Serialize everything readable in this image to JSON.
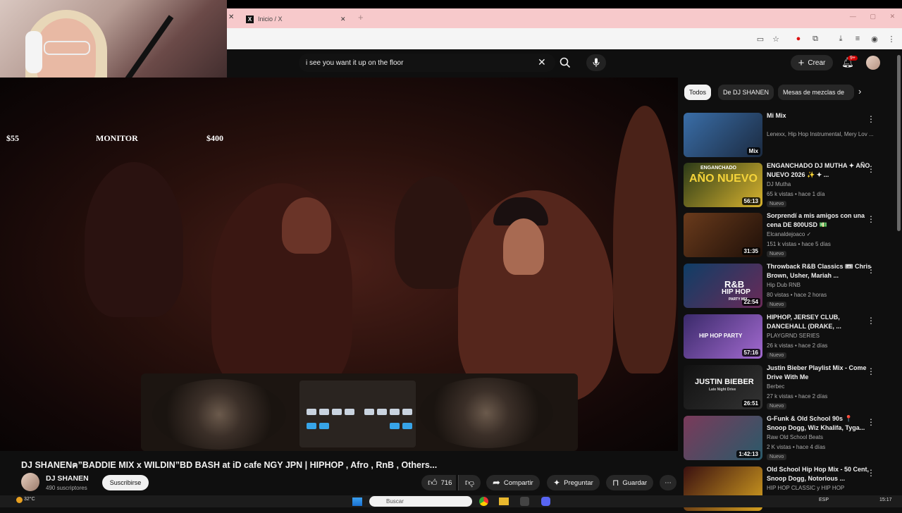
{
  "overlay": {
    "monitor_left": "$55",
    "monitor_label": "MONITOR",
    "monitor_right": "$400",
    "progress": 0.13
  },
  "browser": {
    "tab_title": "Inicio / X",
    "close_glyph": "✕",
    "new_tab_glyph": "+"
  },
  "youtube": {
    "search_value": "i see you want it up on the floor",
    "create_label": "Crear",
    "notif_count": "9+"
  },
  "video": {
    "title": "DJ SHANENฅ”BADDIE MIX x WILDIN”BD BASH at iD cafe NGY JPN | HIPHOP , Afro , RnB , Others...",
    "channel": "DJ SHANEN",
    "subscribers": "490 suscriptores",
    "subscribe_label": "Suscribirse",
    "likes": "716",
    "share_label": "Compartir",
    "ask_label": "Preguntar",
    "save_label": "Guardar"
  },
  "chips": [
    "Todos",
    "De DJ SHANEN",
    "Mesas de mezclas de"
  ],
  "recs": [
    {
      "title": "Mi Mix",
      "channel": "Lenexx, Hip Hop Instrumental, Mery Lov ...",
      "meta": "",
      "badge": "",
      "duration": "Mix",
      "colors": [
        "#3a6ea8",
        "#1b2a40"
      ]
    },
    {
      "title": "ENGANCHADO DJ MUTHA ✦ AÑO NUEVO 2026 ✨ ✦ ...",
      "channel": "DJ Mutha",
      "meta": "65 k vistas • hace 1 día",
      "badge": "Nuevo",
      "duration": "56:13",
      "colors": [
        "#2b3a18",
        "#d8b32e"
      ]
    },
    {
      "title": "Sorprendí a mis amigos con una cena DE 800USD 💵",
      "channel": "Elcanaldejoaco ✓",
      "meta": "151 k vistas • hace 5 días",
      "badge": "Nuevo",
      "duration": "31:35",
      "colors": [
        "#6a3b1c",
        "#1e0f08"
      ]
    },
    {
      "title": "Throwback R&B Classics 🎟 Chris Brown, Usher, Mariah ...",
      "channel": "Hip Dub RNB",
      "meta": "80 vistas • hace 2 horas",
      "badge": "Nuevo",
      "duration": "22:54",
      "colors": [
        "#0f3e66",
        "#6a2a58"
      ]
    },
    {
      "title": "HIPHOP, JERSEY CLUB, DANCEHALL (DRAKE, ...",
      "channel": "PLAYGRND SERIES",
      "meta": "26 k vistas • hace 2 días",
      "badge": "Nuevo",
      "duration": "57:16",
      "colors": [
        "#3a2a6a",
        "#a36ad0"
      ]
    },
    {
      "title": "Justin Bieber Playlist Mix - Come Drive With Me",
      "channel": "Berbec",
      "meta": "27 k vistas • hace 2 días",
      "badge": "Nuevo",
      "duration": "26:51",
      "colors": [
        "#111111",
        "#333333"
      ]
    },
    {
      "title": "G-Funk & Old School 90s 📍 Snoop Dogg, Wiz Khalifa, Tyga...",
      "channel": "Raw Old School Beats",
      "meta": "2 K vistas • hace 4 días",
      "badge": "Nuevo",
      "duration": "1:42:13",
      "colors": [
        "#7a3a5a",
        "#2a5a6a"
      ]
    },
    {
      "title": "Old School Hip Hop Mix - 50 Cent, Snoop Dogg, Notorious ...",
      "channel": "HIP HOP CLASSIC y HIP HOP",
      "meta": "",
      "badge": "",
      "duration": "",
      "colors": [
        "#3a1010",
        "#d4a020"
      ]
    }
  ],
  "thumb_text": {
    "engan_top": "ENGANCHADO",
    "engan_big": "AÑO NUEVO",
    "rnb_big": "R&B",
    "rnb_sub": "HIP HOP",
    "rnb_party": "PARTY MIX",
    "hh_party": "HIP HOP PARTY",
    "jb_big": "JUSTIN BIEBER",
    "jb_sub": "Late Night Drive"
  },
  "taskbar": {
    "weather": "32°C",
    "search_placeholder": "Buscar",
    "lang": "ESP",
    "clock": "15:17"
  }
}
